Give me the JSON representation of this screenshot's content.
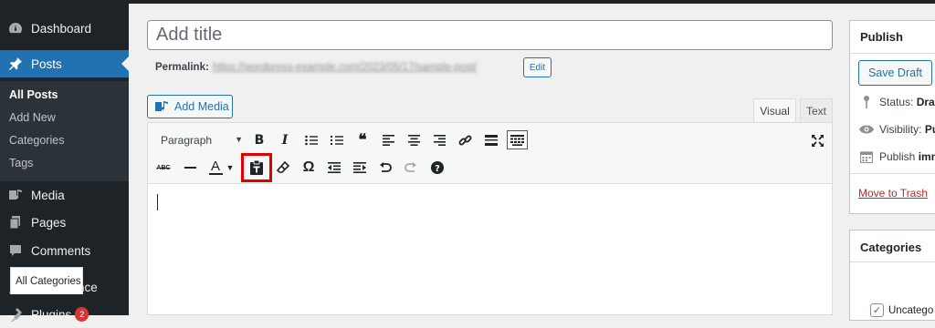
{
  "sidebar": {
    "items": [
      {
        "label": "Dashboard",
        "icon": "dashboard-icon"
      },
      {
        "label": "Posts",
        "icon": "pushpin-icon"
      },
      {
        "label": "Media",
        "icon": "media-icon"
      },
      {
        "label": "Pages",
        "icon": "pages-icon"
      },
      {
        "label": "Comments",
        "icon": "comments-icon"
      },
      {
        "label": "Appearance",
        "icon": "brush-icon"
      },
      {
        "label": "Plugins",
        "icon": "plugin-icon",
        "badge": "2"
      }
    ],
    "submenu": [
      "All Posts",
      "Add New",
      "Categories",
      "Tags"
    ]
  },
  "editor": {
    "title_placeholder": "Add title",
    "permalink_label": "Permalink:",
    "permalink_url": "https://wordpress-example.com/2023/05/17/sample-post/",
    "edit_button": "Edit",
    "add_media": "Add Media",
    "tabs": {
      "visual": "Visual",
      "text": "Text"
    },
    "format_select": "Paragraph",
    "toolbar_row1": [
      "bold",
      "italic",
      "bulleted-list",
      "numbered-list",
      "blockquote",
      "align-left",
      "align-center",
      "align-right",
      "insert-link",
      "read-more",
      "toolbar-toggle"
    ],
    "toolbar_row2": [
      "strikethrough",
      "horizontal-line",
      "text-color",
      "paste-as-text",
      "clear-formatting",
      "special-character",
      "decrease-indent",
      "increase-indent",
      "undo",
      "redo",
      "keyboard-shortcuts"
    ],
    "highlighted_button": "paste-as-text",
    "highlight_color": "#e00000"
  },
  "publish": {
    "title": "Publish",
    "save_draft": "Save Draft",
    "status_label": "Status:",
    "status_value": "Draft",
    "visibility_label": "Visibility:",
    "visibility_value": "Pu",
    "publish_label": "Publish",
    "publish_value": "imm",
    "move_to_trash": "Move to Trash"
  },
  "categories": {
    "title": "Categories",
    "tab_all": "All Categories",
    "items": [
      {
        "label": "Uncatego",
        "checked": true
      }
    ]
  },
  "colors": {
    "accent": "#2271b1",
    "sidebar_bg": "#1d2327",
    "danger": "#b32d2e"
  }
}
